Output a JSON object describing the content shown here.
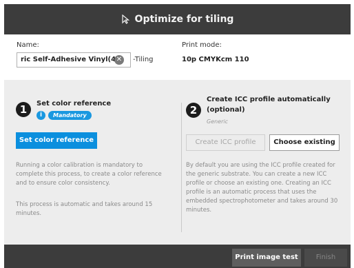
{
  "dialog": {
    "title": "Optimize for tiling",
    "name_label": "Name:",
    "name_value": "ric Self-Adhesive Vinyl(4)",
    "name_suffix": "-Tiling",
    "print_mode_label": "Print mode:",
    "print_mode_value": "10p CMYKcm 110"
  },
  "left_section": {
    "step": "1",
    "title": "Set color reference",
    "badge": "Mandatory",
    "button": "Set color reference",
    "description_1": "Running a color calibration is mandatory to complete this process, to create a color reference and to ensure color consistency.",
    "description_2": "This process is automatic and takes around 15 minutes."
  },
  "right_section": {
    "step": "2",
    "title_line1": "Create ICC profile automatically",
    "title_line2": "(optional)",
    "subtitle": "Generic",
    "button_create": "Create ICC profile",
    "button_choose": "Choose existing",
    "description": "By default you are using the ICC profile created for the generic substrate. You can create a new ICC profile or choose an existing one. Creating an ICC profile is an automatic process that uses the embedded spectrophotometer and takes around 30 minutes."
  },
  "footer": {
    "print_button": "Print image test",
    "finish_button": "Finish"
  },
  "colors": {
    "accent": "#0b8fde",
    "titlebar": "#3c3c3c",
    "panel": "#ededed"
  },
  "icons": {
    "title": "tiling-cursor-icon",
    "clear": "clear-x-icon",
    "info": "info-icon"
  }
}
